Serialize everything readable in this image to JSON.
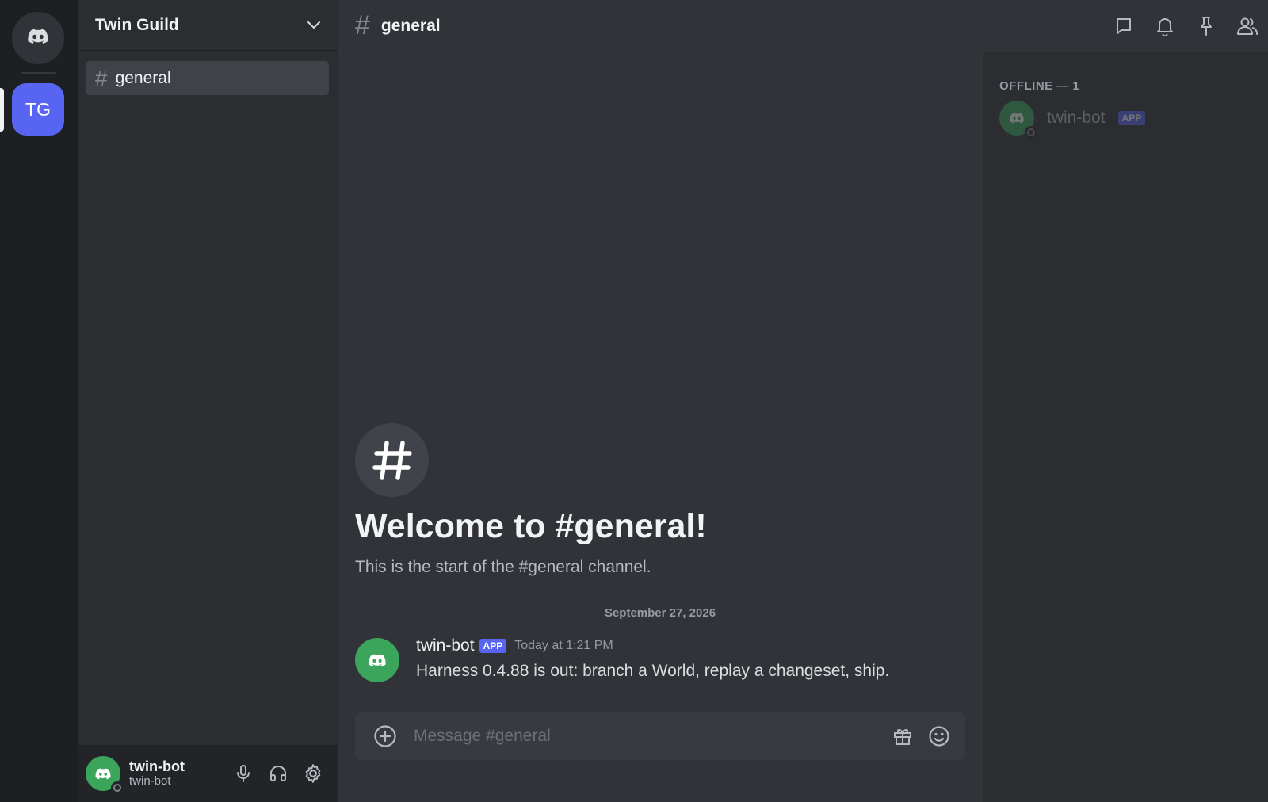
{
  "rail": {
    "server_initials": "TG"
  },
  "sidebar": {
    "guild_name": "Twin Guild",
    "channels": [
      {
        "name": "general",
        "selected": true
      }
    ],
    "user": {
      "display_name": "twin-bot",
      "username": "twin-bot"
    }
  },
  "chat": {
    "channel_name": "general",
    "welcome_title": "Welcome to #general!",
    "welcome_subtitle": "This is the start of the #general channel.",
    "date_divider": "September 27, 2026",
    "messages": [
      {
        "author": "twin-bot",
        "badge": "APP",
        "time": "Today at 1:21 PM",
        "text": "Harness 0.4.88 is out: branch a World, replay a changeset, ship."
      }
    ],
    "composer_placeholder": "Message #general"
  },
  "members": {
    "offline_header": "OFFLINE — 1",
    "list": [
      {
        "name": "twin-bot",
        "badge": "APP"
      }
    ]
  },
  "icons": {
    "home": "discord-logo-icon",
    "guild_menu": "chevron-down-icon",
    "threads": "threads-icon",
    "notifications": "bell-icon",
    "pins": "pin-icon",
    "member_list": "members-icon",
    "attach": "plus-circle-icon",
    "gift": "gift-icon",
    "emoji": "emoji-icon",
    "mic": "microphone-icon",
    "headphones": "headphones-icon",
    "settings": "gear-icon"
  },
  "colors": {
    "accent": "#5865f2",
    "bot_avatar": "#3ba55c",
    "background": "#313338",
    "sidebar": "#2b2d31",
    "rail": "#1e1f22"
  }
}
